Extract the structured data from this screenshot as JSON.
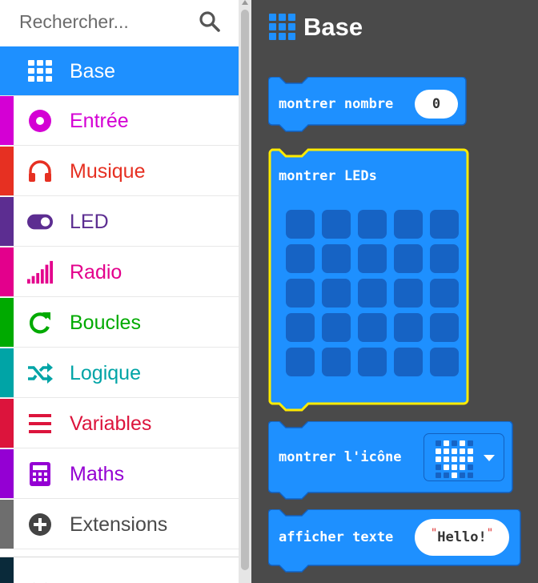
{
  "search": {
    "placeholder": "Rechercher..."
  },
  "categories": [
    {
      "label": "Base",
      "color": "#1e90ff",
      "icon": "grid-icon",
      "active": true
    },
    {
      "label": "Entrée",
      "color": "#d400d4",
      "icon": "circle-dot-icon"
    },
    {
      "label": "Musique",
      "color": "#e63022",
      "icon": "headphones-icon"
    },
    {
      "label": "LED",
      "color": "#5c2d91",
      "icon": "toggle-icon"
    },
    {
      "label": "Radio",
      "color": "#e3008c",
      "icon": "signal-bars-icon"
    },
    {
      "label": "Boucles",
      "color": "#00aa00",
      "icon": "refresh-icon"
    },
    {
      "label": "Logique",
      "color": "#00a4a6",
      "icon": "shuffle-icon"
    },
    {
      "label": "Variables",
      "color": "#dc143c",
      "icon": "list-icon"
    },
    {
      "label": "Maths",
      "color": "#9400d3",
      "icon": "calculator-icon"
    },
    {
      "label": "Extensions",
      "color": "#6e6e6e",
      "icon": "plus-circle-icon"
    }
  ],
  "flyout": {
    "title": "Base",
    "title_icon": "grid-icon",
    "blocks": {
      "show_number": {
        "label": "montrer nombre",
        "value": "0"
      },
      "show_leds": {
        "label": "montrer LEDs",
        "selected_highlight": "#ffeb00"
      },
      "show_icon": {
        "label": "montrer l'icône",
        "selected_icon": "heart-icon"
      },
      "show_string": {
        "label": "afficher texte",
        "value": "Hello!"
      }
    }
  },
  "colors": {
    "block": "#1e90ff",
    "block_border": "#1260bf",
    "led_off": "#1663c4",
    "workspace": "#4a4a4a"
  }
}
